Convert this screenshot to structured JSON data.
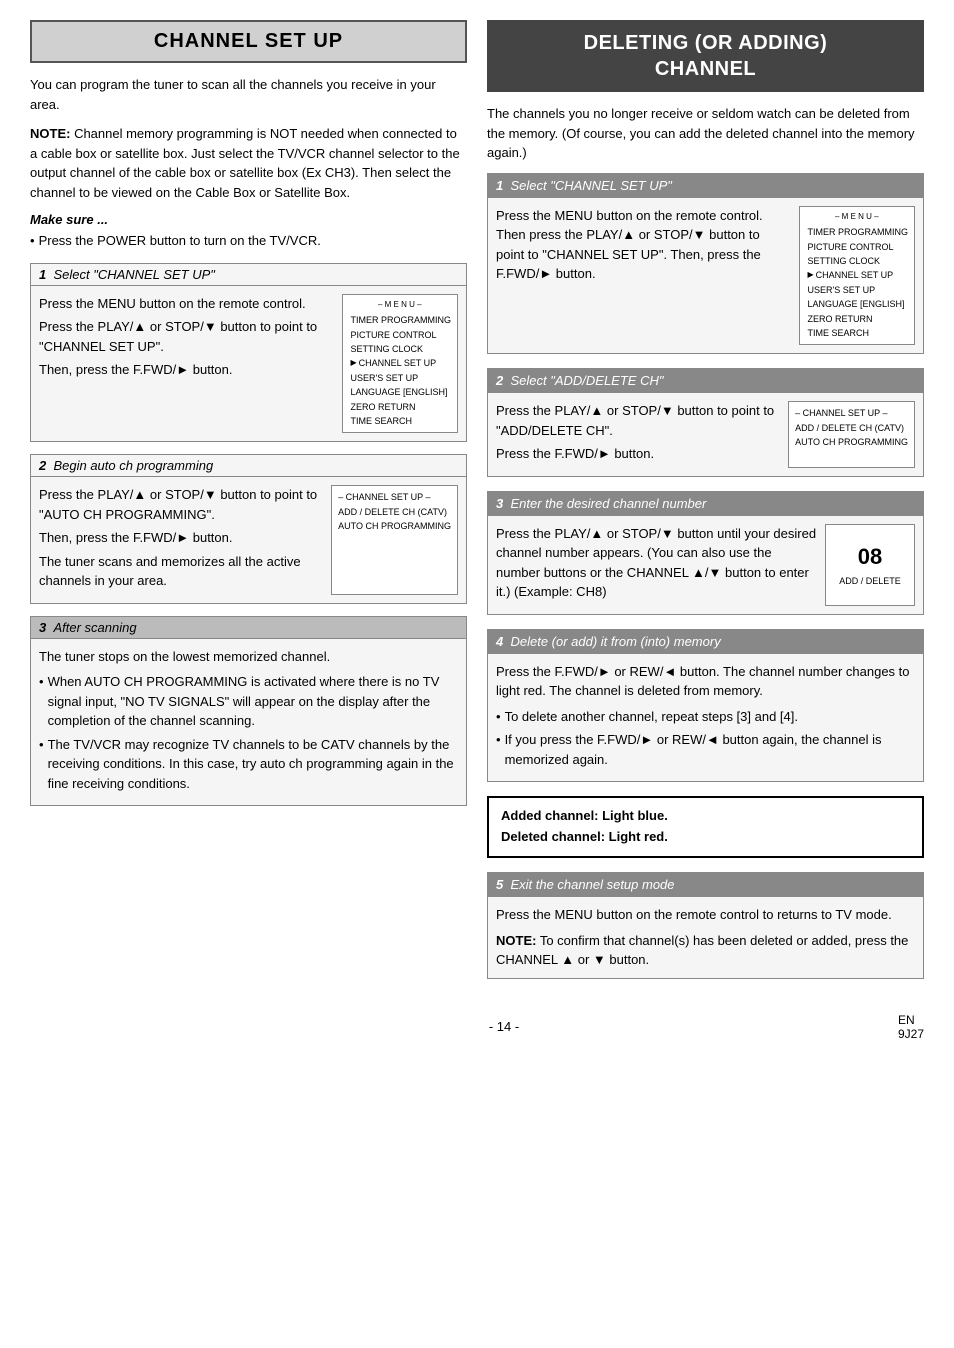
{
  "left": {
    "header": "CHANNEL SET UP",
    "intro": "You can program the tuner to scan all the channels you receive in your area.",
    "note_label": "NOTE:",
    "note_text": " Channel memory programming is NOT needed when connected to a cable box or satellite box. Just select the TV/VCR channel selector to the output channel of the cable box or satellite box (Ex CH3). Then select the channel to be viewed on the Cable Box or Satellite Box.",
    "make_sure_label": "Make sure ...",
    "make_sure_bullet": "Press the POWER button to turn on the TV/VCR.",
    "step1": {
      "num": "1",
      "title": "Select \"CHANNEL SET UP\"",
      "text1": "Press the MENU button on the remote control.",
      "text2": "Press the PLAY/▲ or STOP/▼ button to point to \"CHANNEL SET UP\".",
      "text3": "Then, press the F.FWD/► button.",
      "menu": {
        "title": "– M E N U –",
        "items": [
          "TIMER PROGRAMMING",
          "PICTURE CONTROL",
          "SETTING CLOCK",
          "CHANNEL SET UP",
          "USER'S SET UP",
          "LANGUAGE  [ENGLISH]",
          "ZERO RETURN",
          "TIME SEARCH"
        ],
        "selected": "CHANNEL SET UP"
      }
    },
    "step2": {
      "num": "2",
      "title": "Begin auto ch programming",
      "text1": "Press the PLAY/▲ or STOP/▼ button to point to \"AUTO CH PROGRAMMING\".",
      "text2": "Then, press the F.FWD/► button.",
      "text3": "The tuner scans and memorizes all the active channels in your area.",
      "menu": {
        "title": "– CHANNEL SET UP –",
        "items": [
          "ADD / DELETE CH (CATV)",
          "AUTO CH PROGRAMMING"
        ],
        "selected": "AUTO CH PROGRAMMING"
      }
    },
    "step3": {
      "num": "3",
      "title": "After scanning",
      "text1": "The tuner stops on the lowest memorized channel.",
      "bullets": [
        "When AUTO CH PROGRAMMING is activated where there is no TV signal input, \"NO TV SIGNALS\" will appear on the display after the completion of the channel scanning.",
        "The TV/VCR may recognize TV channels to be CATV channels by the receiving conditions. In this case, try auto ch programming again in the fine receiving conditions."
      ]
    }
  },
  "right": {
    "header_line1": "DELETING (OR ADDING)",
    "header_line2": "CHANNEL",
    "intro": "The channels you no longer receive or seldom watch can be deleted from the memory. (Of course, you can add the deleted channel into the memory again.)",
    "step1": {
      "num": "1",
      "title": "Select \"CHANNEL SET UP\"",
      "text1": "Press the MENU button on the remote control. Then press the PLAY/▲ or STOP/▼ button to point to \"CHANNEL SET UP\". Then, press the F.FWD/► button.",
      "menu": {
        "title": "– M E N U –",
        "items": [
          "TIMER PROGRAMMING",
          "PICTURE CONTROL",
          "SETTING CLOCK",
          "CHANNEL SET UP",
          "USER'S SET UP",
          "LANGUAGE  [ENGLISH]",
          "ZERO RETURN",
          "TIME SEARCH"
        ],
        "selected": "CHANNEL SET UP"
      }
    },
    "step2": {
      "num": "2",
      "title": "Select \"ADD/DELETE CH\"",
      "text1": "Press the PLAY/▲ or STOP/▼ button to point to \"ADD/DELETE CH\".",
      "text2": "Press the F.FWD/► button.",
      "menu": {
        "title": "– CHANNEL SET UP –",
        "items": [
          "ADD / DELETE CH (CATV)",
          "AUTO CH PROGRAMMING"
        ],
        "selected": "ADD / DELETE CH (CATV)"
      }
    },
    "step3": {
      "num": "3",
      "title": "Enter the desired channel number",
      "text1": "Press the PLAY/▲ or STOP/▼ button until your desired channel number appears. (You can also use the number buttons  or the CHANNEL ▲/▼ button to enter it.) (Example: CH8)",
      "display": {
        "number": "08",
        "label": "ADD / DELETE"
      }
    },
    "step4": {
      "num": "4",
      "title": "Delete (or add) it from (into) memory",
      "text1": "Press the F.FWD/► or REW/◄ button. The channel number changes to light red. The channel is deleted from memory.",
      "bullets": [
        "To delete another channel, repeat steps [3] and [4].",
        "If you press the F.FWD/► or REW/◄ button again, the channel is memorized again."
      ]
    },
    "note_box": {
      "line1": "Added channel: Light blue.",
      "line2": "Deleted channel: Light red."
    },
    "step5": {
      "num": "5",
      "title": "Exit the channel setup mode",
      "text1": "Press the MENU button on the remote control to returns to TV mode.",
      "note_label": "NOTE:",
      "note_text": " To confirm that channel(s) has been deleted or added, press the CHANNEL ▲ or ▼ button."
    }
  },
  "footer": {
    "page_number": "- 14 -",
    "code": "EN\n9J27"
  }
}
